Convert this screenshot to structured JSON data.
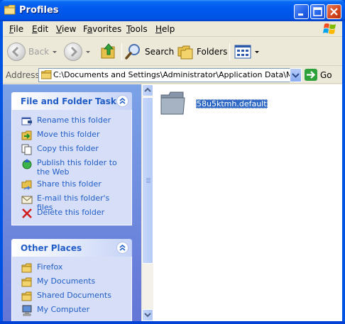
{
  "window": {
    "title": "Profiles",
    "minimize_icon": "minimize-icon",
    "maximize_icon": "maximize-icon",
    "close_icon": "close-icon"
  },
  "menu": {
    "items": [
      {
        "label": "File",
        "key": "F"
      },
      {
        "label": "Edit",
        "key": "E"
      },
      {
        "label": "View",
        "key": "V"
      },
      {
        "label": "Favorites",
        "key": "a"
      },
      {
        "label": "Tools",
        "key": "T"
      },
      {
        "label": "Help",
        "key": "H"
      }
    ]
  },
  "toolbar": {
    "back_label": "Back",
    "search_label": "Search",
    "folders_label": "Folders"
  },
  "address": {
    "label": "Address",
    "value": "C:\\Documents and Settings\\Administrator\\Application Data\\Mozilla\\Firefox\\Profiles",
    "go_label": "Go"
  },
  "tasks": {
    "file_folder": {
      "title": "File and Folder Tasks",
      "items": [
        {
          "label": "Rename this folder",
          "icon": "rename-icon"
        },
        {
          "label": "Move this folder",
          "icon": "move-icon"
        },
        {
          "label": "Copy this folder",
          "icon": "copy-icon"
        },
        {
          "label": "Publish this folder to the Web",
          "icon": "publish-web-icon"
        },
        {
          "label": "Share this folder",
          "icon": "share-icon"
        },
        {
          "label": "E-mail this folder's files",
          "icon": "email-icon"
        },
        {
          "label": "Delete this folder",
          "icon": "delete-icon"
        }
      ]
    },
    "other_places": {
      "title": "Other Places",
      "items": [
        {
          "label": "Firefox",
          "icon": "folder-icon"
        },
        {
          "label": "My Documents",
          "icon": "folder-icon"
        },
        {
          "label": "Shared Documents",
          "icon": "folder-icon"
        },
        {
          "label": "My Computer",
          "icon": "computer-icon"
        }
      ]
    }
  },
  "content": {
    "items": [
      {
        "name": "58u5ktmh.default",
        "selected": true,
        "icon": "folder-icon"
      }
    ]
  },
  "colors": {
    "title_blue": "#0054e3",
    "task_link": "#215dc6",
    "selection": "#316ac5"
  }
}
